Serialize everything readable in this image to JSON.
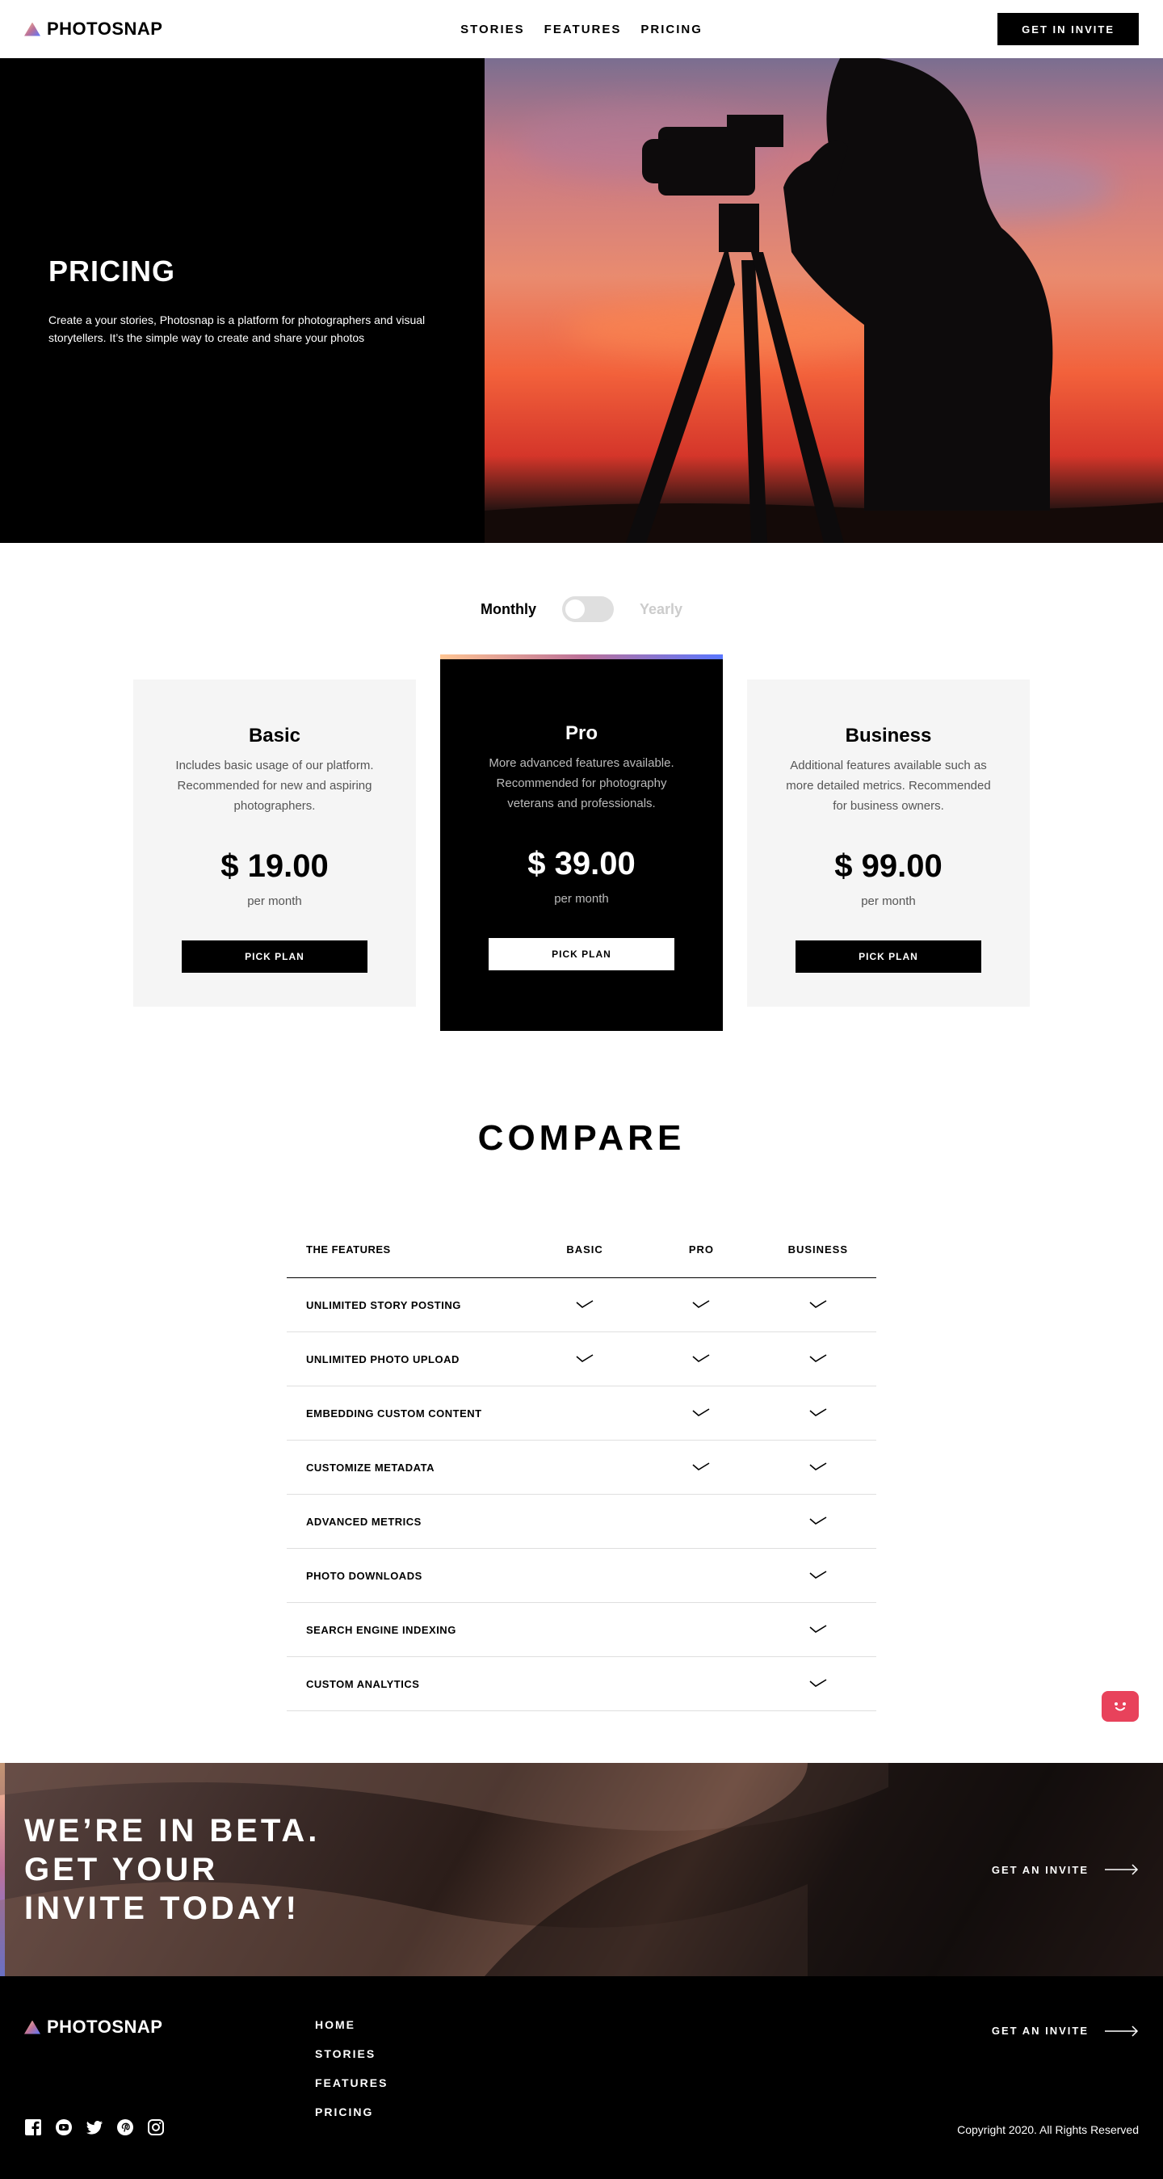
{
  "header": {
    "logo": "PHOTOSNAP",
    "nav": [
      "STORIES",
      "FEATURES",
      "PRICING"
    ],
    "cta": "GET IN INVITE"
  },
  "hero": {
    "title": "PRICING",
    "description": "Create a your stories, Photosnap is a platform for photographers and visual storytellers. It’s the simple way to create and share your photos"
  },
  "billing": {
    "monthly": "Monthly",
    "yearly": "Yearly",
    "selected": "Monthly"
  },
  "plans": [
    {
      "name": "Basic",
      "description": "Includes basic usage of our platform. Recommended for new and aspiring photographers.",
      "price": "$ 19.00",
      "period": "per month",
      "button": "PICK PLAN"
    },
    {
      "name": "Pro",
      "description": "More advanced features available. Recommended for photography veterans and professionals.",
      "price": "$ 39.00",
      "period": "per month",
      "button": "PICK PLAN"
    },
    {
      "name": "Business",
      "description": "Additional features available such as more detailed metrics. Recommended for business owners.",
      "price": "$ 99.00",
      "period": "per month",
      "button": "PICK PLAN"
    }
  ],
  "compare": {
    "title": "COMPARE",
    "headers": [
      "THE FEATURES",
      "BASIC",
      "PRO",
      "BUSINESS"
    ],
    "rows": [
      {
        "feature": "UNLIMITED STORY POSTING",
        "basic": true,
        "pro": true,
        "business": true
      },
      {
        "feature": "UNLIMITED PHOTO UPLOAD",
        "basic": true,
        "pro": true,
        "business": true
      },
      {
        "feature": "EMBEDDING CUSTOM CONTENT",
        "basic": false,
        "pro": true,
        "business": true
      },
      {
        "feature": "CUSTOMIZE METADATA",
        "basic": false,
        "pro": true,
        "business": true
      },
      {
        "feature": "ADVANCED METRICS",
        "basic": false,
        "pro": false,
        "business": true
      },
      {
        "feature": "PHOTO DOWNLOADS",
        "basic": false,
        "pro": false,
        "business": true
      },
      {
        "feature": "SEARCH ENGINE INDEXING",
        "basic": false,
        "pro": false,
        "business": true
      },
      {
        "feature": "CUSTOM ANALYTICS",
        "basic": false,
        "pro": false,
        "business": true
      }
    ]
  },
  "beta": {
    "line1": "WE’RE IN BETA.",
    "line2": "GET YOUR",
    "line3": "INVITE TODAY!",
    "cta": "GET AN INVITE"
  },
  "footer": {
    "logo": "PHOTOSNAP",
    "links": [
      "HOME",
      "STORIES",
      "FEATURES",
      "PRICING"
    ],
    "cta": "GET AN INVITE",
    "copyright": "Copyright 2020. All Rights Reserved",
    "social_icons": [
      "facebook-icon",
      "youtube-icon",
      "twitter-icon",
      "pinterest-icon",
      "instagram-icon"
    ]
  },
  "colors": {
    "accent_gradient": [
      "#ffc593",
      "#bc7198",
      "#5a77ff"
    ],
    "chat_bubble": "#e8425b"
  }
}
